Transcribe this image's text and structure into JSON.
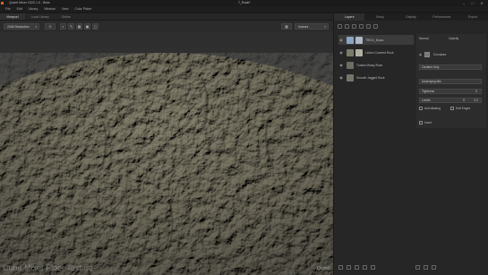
{
  "window": {
    "app_title": "Quixel Mixer 2022.1.0 - Beta",
    "document_title": "7_Rock*",
    "minimize": "–",
    "maximize": "□",
    "close": "✕"
  },
  "menu": [
    "File",
    "Edit",
    "Library",
    "Window",
    "View",
    "Color Picker"
  ],
  "left_tabs": [
    {
      "label": "Viewport",
      "active": true
    },
    {
      "label": "Local Library",
      "active": false
    },
    {
      "label": "Online",
      "active": false
    }
  ],
  "toolbar": {
    "resolution_value": "2048 Resolution",
    "environment_value": "Indoors",
    "icons": [
      "camera-icon",
      "paint-icon",
      "brush-icon",
      "grid-icon",
      "layout-icon",
      "mesh-icon"
    ]
  },
  "viewport": {
    "label": "Cube Mixer Floor Texture",
    "brand": "Quixel"
  },
  "right_tabs": [
    {
      "label": "Layers",
      "active": true
    },
    {
      "label": "Setup",
      "active": false
    },
    {
      "label": "Display",
      "active": false
    },
    {
      "label": "Performance",
      "active": false
    },
    {
      "label": "Export",
      "active": false
    }
  ],
  "layers": [
    {
      "name": "TRIDC_Brass",
      "selected": true,
      "color": "#8aa6c4",
      "color2": "#aeb8c6"
    },
    {
      "name": "Lichen Covered Rock",
      "selected": false,
      "color": "#7b7b6a",
      "color2": "#b0b0a0"
    },
    {
      "name": "Tundra Mossy Rock",
      "selected": false,
      "color": "#6d6d62",
      "color2": ""
    },
    {
      "name": "Smooth Jagged Rock",
      "selected": false,
      "color": "#75756a",
      "color2": ""
    }
  ],
  "properties": {
    "blend_mode": "Normal",
    "opacity_label": "Opacity",
    "mask_label": "Curvature",
    "mask_mode": "Cavities Only",
    "mode2": "Underlying Mix",
    "tightness_label": "Tightness",
    "tightness_value": "0",
    "levels_label": "Levels",
    "levels_min": "0",
    "levels_max": "0.2",
    "anti_aliasing_label": "Anti-aliasing",
    "soft_edges_label": "Soft Edges",
    "invert_label": "Invert"
  }
}
